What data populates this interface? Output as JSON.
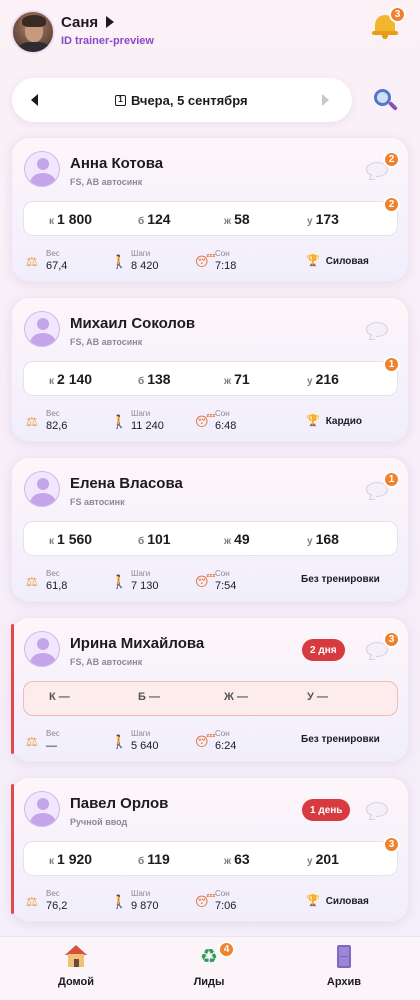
{
  "header": {
    "user_name": "Саня",
    "user_id": "ID trainer-preview",
    "notifications_count": "3"
  },
  "datebar": {
    "calendar_glyph": "1",
    "date_label": "Вчера, 5 сентября"
  },
  "labels": {
    "kcal": "к",
    "protein": "б",
    "fat": "ж",
    "carbs": "у",
    "weight": "Вес",
    "steps": "Шаги",
    "sleep": "Сон"
  },
  "clients": [
    {
      "name": "Анна Котова",
      "source": "FS, AB автосинк",
      "chat_badge": "2",
      "macro_badge": "2",
      "pill": "",
      "kcal": "1 800",
      "protein": "124",
      "fat": "58",
      "carbs": "173",
      "weight": "67,4",
      "steps": "8 420",
      "sleep": "7:18",
      "training": "Силовая"
    },
    {
      "name": "Михаил Соколов",
      "source": "FS, AB автосинк",
      "chat_badge": "",
      "macro_badge": "1",
      "pill": "",
      "kcal": "2 140",
      "protein": "138",
      "fat": "71",
      "carbs": "216",
      "weight": "82,6",
      "steps": "11 240",
      "sleep": "6:48",
      "training": "Кардио"
    },
    {
      "name": "Елена Власова",
      "source": "FS автосинк",
      "chat_badge": "1",
      "macro_badge": "",
      "pill": "",
      "kcal": "1 560",
      "protein": "101",
      "fat": "49",
      "carbs": "168",
      "weight": "61,8",
      "steps": "7 130",
      "sleep": "7:54",
      "training": "Без тренировки"
    },
    {
      "name": "Ирина Михайлова",
      "source": "FS, AB автосинк",
      "chat_badge": "3",
      "macro_badge": "",
      "pill": "2 дня",
      "kcal": "К —",
      "protein": "Б —",
      "fat": "Ж —",
      "carbs": "У —",
      "weight": "—",
      "steps": "5 640",
      "sleep": "6:24",
      "training": "Без тренировки"
    },
    {
      "name": "Павел Орлов",
      "source": "Ручной ввод",
      "chat_badge": "",
      "macro_badge": "3",
      "pill": "1 день",
      "kcal": "1 920",
      "protein": "119",
      "fat": "63",
      "carbs": "201",
      "weight": "76,2",
      "steps": "9 870",
      "sleep": "7:06",
      "training": "Силовая"
    }
  ],
  "nav": {
    "home": "Домой",
    "leads": "Лиды",
    "leads_badge": "4",
    "archive": "Архив"
  }
}
